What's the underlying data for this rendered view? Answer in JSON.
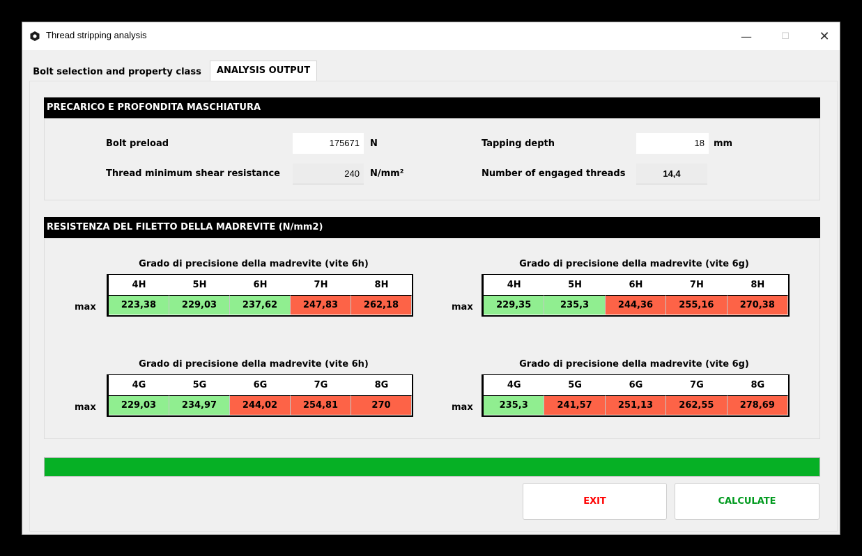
{
  "window": {
    "title": "Thread stripping analysis"
  },
  "tabs": [
    {
      "label": "Bolt selection and property class"
    },
    {
      "label": "ANALYSIS OUTPUT"
    }
  ],
  "section1": {
    "header": "PRECARICO E PROFONDITA MASCHIATURA",
    "bolt_preload_label": "Bolt preload",
    "bolt_preload_value": "175671",
    "bolt_preload_unit": "N",
    "shear_label": "Thread minimum shear resistance",
    "shear_value": "240",
    "shear_unit": "N/mm²",
    "tapping_label": "Tapping depth",
    "tapping_value": "18",
    "tapping_unit": "mm",
    "engaged_label": "Number of engaged threads",
    "engaged_value": "14,4"
  },
  "section2": {
    "header": "RESISTENZA DEL FILETTO DELLA MADREVITE (N/mm2)",
    "row_label": "max",
    "tables": [
      {
        "title": "Grado di precisione della madrevite (vite 6h)",
        "headers": [
          "4H",
          "5H",
          "6H",
          "7H",
          "8H"
        ],
        "values": [
          "223,38",
          "229,03",
          "237,62",
          "247,83",
          "262,18"
        ],
        "status": [
          "ok",
          "ok",
          "ok",
          "bad",
          "bad"
        ]
      },
      {
        "title": "Grado di precisione della madrevite (vite 6g)",
        "headers": [
          "4H",
          "5H",
          "6H",
          "7H",
          "8H"
        ],
        "values": [
          "229,35",
          "235,3",
          "244,36",
          "255,16",
          "270,38"
        ],
        "status": [
          "ok",
          "ok",
          "bad",
          "bad",
          "bad"
        ]
      },
      {
        "title": "Grado di precisione della madrevite (vite 6h)",
        "headers": [
          "4G",
          "5G",
          "6G",
          "7G",
          "8G"
        ],
        "values": [
          "229,03",
          "234,97",
          "244,02",
          "254,81",
          "270"
        ],
        "status": [
          "ok",
          "ok",
          "bad",
          "bad",
          "bad"
        ]
      },
      {
        "title": "Grado di precisione della madrevite (vite 6g)",
        "headers": [
          "4G",
          "5G",
          "6G",
          "7G",
          "8G"
        ],
        "values": [
          "235,3",
          "241,57",
          "251,13",
          "262,55",
          "278,69"
        ],
        "status": [
          "ok",
          "bad",
          "bad",
          "bad",
          "bad"
        ]
      }
    ]
  },
  "progress": {
    "value_percent": 100,
    "color": "#06b025"
  },
  "buttons": {
    "exit_label": "EXIT",
    "exit_color": "#ff0000",
    "calculate_label": "CALCULATE",
    "calculate_color": "#009a1e"
  },
  "colors": {
    "ok": "#90ee90",
    "bad": "#fd6347"
  }
}
